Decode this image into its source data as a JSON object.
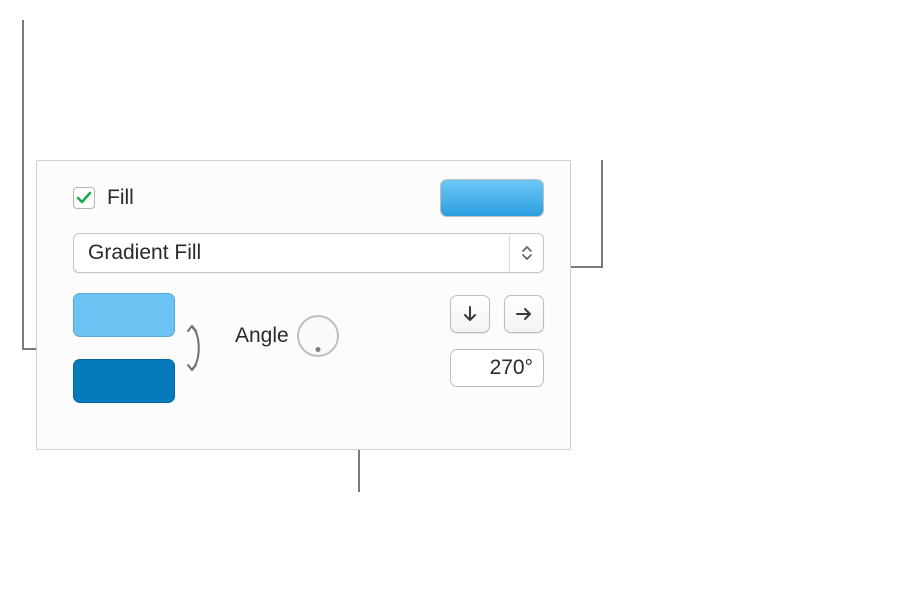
{
  "fill": {
    "checkbox_checked": true,
    "label": "Fill",
    "preview_gradient": {
      "start": "#6ec8f7",
      "end": "#2b9fe0"
    },
    "type_dropdown": {
      "selected": "Gradient Fill"
    },
    "gradient_stops": {
      "color1": "#6bc4f4",
      "color2": "#047abb"
    },
    "angle": {
      "label": "Angle",
      "value": "270°"
    }
  }
}
